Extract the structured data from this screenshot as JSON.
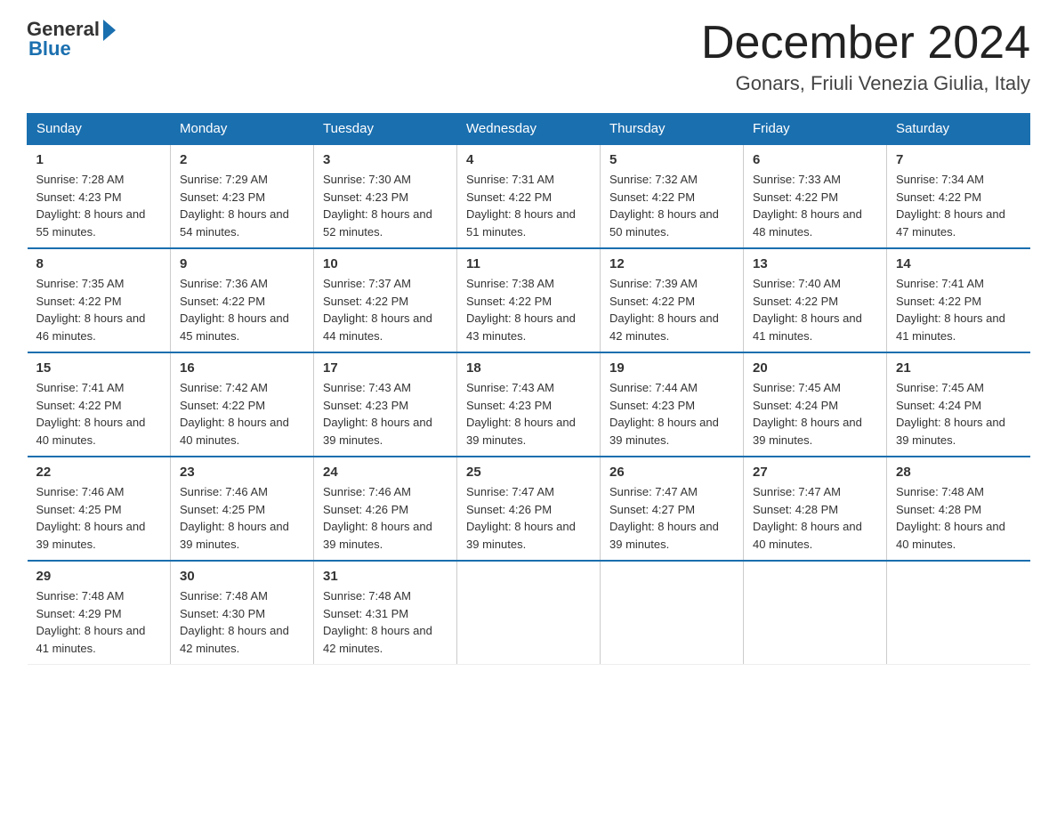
{
  "header": {
    "logo_general": "General",
    "logo_blue": "Blue",
    "month_title": "December 2024",
    "subtitle": "Gonars, Friuli Venezia Giulia, Italy"
  },
  "days_of_week": [
    "Sunday",
    "Monday",
    "Tuesday",
    "Wednesday",
    "Thursday",
    "Friday",
    "Saturday"
  ],
  "weeks": [
    [
      {
        "num": "1",
        "sunrise": "7:28 AM",
        "sunset": "4:23 PM",
        "daylight": "8 hours and 55 minutes."
      },
      {
        "num": "2",
        "sunrise": "7:29 AM",
        "sunset": "4:23 PM",
        "daylight": "8 hours and 54 minutes."
      },
      {
        "num": "3",
        "sunrise": "7:30 AM",
        "sunset": "4:23 PM",
        "daylight": "8 hours and 52 minutes."
      },
      {
        "num": "4",
        "sunrise": "7:31 AM",
        "sunset": "4:22 PM",
        "daylight": "8 hours and 51 minutes."
      },
      {
        "num": "5",
        "sunrise": "7:32 AM",
        "sunset": "4:22 PM",
        "daylight": "8 hours and 50 minutes."
      },
      {
        "num": "6",
        "sunrise": "7:33 AM",
        "sunset": "4:22 PM",
        "daylight": "8 hours and 48 minutes."
      },
      {
        "num": "7",
        "sunrise": "7:34 AM",
        "sunset": "4:22 PM",
        "daylight": "8 hours and 47 minutes."
      }
    ],
    [
      {
        "num": "8",
        "sunrise": "7:35 AM",
        "sunset": "4:22 PM",
        "daylight": "8 hours and 46 minutes."
      },
      {
        "num": "9",
        "sunrise": "7:36 AM",
        "sunset": "4:22 PM",
        "daylight": "8 hours and 45 minutes."
      },
      {
        "num": "10",
        "sunrise": "7:37 AM",
        "sunset": "4:22 PM",
        "daylight": "8 hours and 44 minutes."
      },
      {
        "num": "11",
        "sunrise": "7:38 AM",
        "sunset": "4:22 PM",
        "daylight": "8 hours and 43 minutes."
      },
      {
        "num": "12",
        "sunrise": "7:39 AM",
        "sunset": "4:22 PM",
        "daylight": "8 hours and 42 minutes."
      },
      {
        "num": "13",
        "sunrise": "7:40 AM",
        "sunset": "4:22 PM",
        "daylight": "8 hours and 41 minutes."
      },
      {
        "num": "14",
        "sunrise": "7:41 AM",
        "sunset": "4:22 PM",
        "daylight": "8 hours and 41 minutes."
      }
    ],
    [
      {
        "num": "15",
        "sunrise": "7:41 AM",
        "sunset": "4:22 PM",
        "daylight": "8 hours and 40 minutes."
      },
      {
        "num": "16",
        "sunrise": "7:42 AM",
        "sunset": "4:22 PM",
        "daylight": "8 hours and 40 minutes."
      },
      {
        "num": "17",
        "sunrise": "7:43 AM",
        "sunset": "4:23 PM",
        "daylight": "8 hours and 39 minutes."
      },
      {
        "num": "18",
        "sunrise": "7:43 AM",
        "sunset": "4:23 PM",
        "daylight": "8 hours and 39 minutes."
      },
      {
        "num": "19",
        "sunrise": "7:44 AM",
        "sunset": "4:23 PM",
        "daylight": "8 hours and 39 minutes."
      },
      {
        "num": "20",
        "sunrise": "7:45 AM",
        "sunset": "4:24 PM",
        "daylight": "8 hours and 39 minutes."
      },
      {
        "num": "21",
        "sunrise": "7:45 AM",
        "sunset": "4:24 PM",
        "daylight": "8 hours and 39 minutes."
      }
    ],
    [
      {
        "num": "22",
        "sunrise": "7:46 AM",
        "sunset": "4:25 PM",
        "daylight": "8 hours and 39 minutes."
      },
      {
        "num": "23",
        "sunrise": "7:46 AM",
        "sunset": "4:25 PM",
        "daylight": "8 hours and 39 minutes."
      },
      {
        "num": "24",
        "sunrise": "7:46 AM",
        "sunset": "4:26 PM",
        "daylight": "8 hours and 39 minutes."
      },
      {
        "num": "25",
        "sunrise": "7:47 AM",
        "sunset": "4:26 PM",
        "daylight": "8 hours and 39 minutes."
      },
      {
        "num": "26",
        "sunrise": "7:47 AM",
        "sunset": "4:27 PM",
        "daylight": "8 hours and 39 minutes."
      },
      {
        "num": "27",
        "sunrise": "7:47 AM",
        "sunset": "4:28 PM",
        "daylight": "8 hours and 40 minutes."
      },
      {
        "num": "28",
        "sunrise": "7:48 AM",
        "sunset": "4:28 PM",
        "daylight": "8 hours and 40 minutes."
      }
    ],
    [
      {
        "num": "29",
        "sunrise": "7:48 AM",
        "sunset": "4:29 PM",
        "daylight": "8 hours and 41 minutes."
      },
      {
        "num": "30",
        "sunrise": "7:48 AM",
        "sunset": "4:30 PM",
        "daylight": "8 hours and 42 minutes."
      },
      {
        "num": "31",
        "sunrise": "7:48 AM",
        "sunset": "4:31 PM",
        "daylight": "8 hours and 42 minutes."
      },
      null,
      null,
      null,
      null
    ]
  ]
}
